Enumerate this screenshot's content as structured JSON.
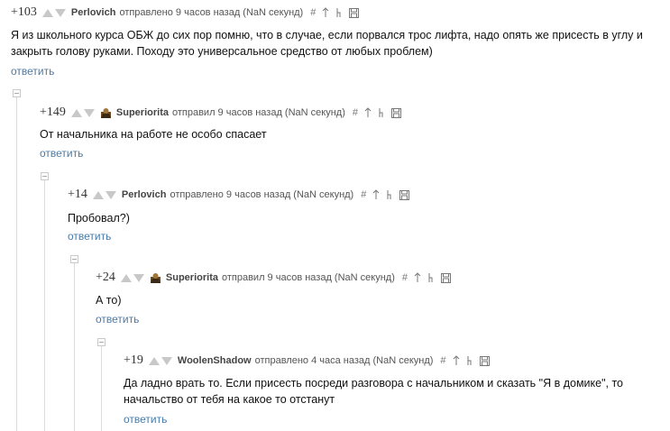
{
  "comments": [
    {
      "rating": "+103",
      "author": "Perlovich",
      "posted": "отправлено 9 часов назад (NaN секунд)",
      "has_avatar": false,
      "text_lines": [
        "Я из школьного курса ОБЖ до сих пор помню, что в случае, если порвался трос лифта, надо опять же присесть в углу и",
        "закрыть голову руками. Походу это универсальное средство от любых проблем)"
      ],
      "reply_label": "ответить"
    },
    {
      "rating": "+149",
      "author": "Superiorita",
      "posted": "отправил 9 часов назад (NaN секунд)",
      "has_avatar": true,
      "text_lines": [
        "От начальника на работе не особо спасает"
      ],
      "reply_label": "ответить"
    },
    {
      "rating": "+14",
      "author": "Perlovich",
      "posted": "отправлено 9 часов назад (NaN секунд)",
      "has_avatar": false,
      "text_lines": [
        "Пробовал?)"
      ],
      "reply_label": "ответить"
    },
    {
      "rating": "+24",
      "author": "Superiorita",
      "posted": "отправил 9 часов назад (NaN секунд)",
      "has_avatar": true,
      "text_lines": [
        "А то)"
      ],
      "reply_label": "ответить"
    },
    {
      "rating": "+19",
      "author": "WoolenShadow",
      "posted": "отправлено 4 часа назад (NaN секунд)",
      "has_avatar": false,
      "text_lines": [
        "Да ладно врать то. Если присесть посреди разговора с начальником и сказать \"Я в домике\", то",
        "начальство от тебя на какое то отстанут"
      ],
      "reply_label": "ответить"
    }
  ],
  "icons": {
    "hash": "#",
    "names": [
      "hash-icon",
      "parent-arrow-icon",
      "branch-icon",
      "save-icon"
    ]
  },
  "colors": {
    "link": "#4a7aa8",
    "arrow": "#c8c8c8",
    "thread_line": "#dcdcdc"
  }
}
